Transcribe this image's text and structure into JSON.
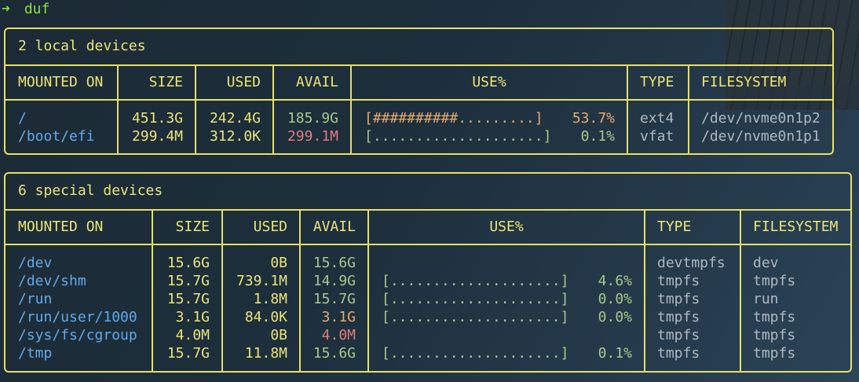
{
  "prompt": {
    "arrow": "➜",
    "command": "duf"
  },
  "local": {
    "title": "2 local devices",
    "headers": [
      "MOUNTED ON",
      "SIZE",
      "USED",
      "AVAIL",
      "USE%",
      "TYPE",
      "FILESYSTEM"
    ],
    "rows": [
      {
        "mount": "/",
        "size": "451.3G",
        "used": "242.4G",
        "avail": "185.9G",
        "bar": "[##########.........]",
        "pct": "53.7%",
        "type": "ext4",
        "fs": "/dev/nvme0n1p2"
      },
      {
        "mount": "/boot/efi",
        "size": "299.4M",
        "used": "312.0K",
        "avail": "299.1M",
        "bar": "[....................]",
        "pct": "0.1%",
        "type": "vfat",
        "fs": "/dev/nvme0n1p1"
      }
    ]
  },
  "special": {
    "title": "6 special devices",
    "headers": [
      "MOUNTED ON",
      "SIZE",
      "USED",
      "AVAIL",
      "USE%",
      "TYPE",
      "FILESYSTEM"
    ],
    "rows": [
      {
        "mount": "/dev",
        "size": "15.6G",
        "used": "0B",
        "avail": "15.6G",
        "bar": "",
        "pct": "",
        "type": "devtmpfs",
        "fs": "dev"
      },
      {
        "mount": "/dev/shm",
        "size": "15.7G",
        "used": "739.1M",
        "avail": "14.9G",
        "bar": "[....................]",
        "pct": "4.6%",
        "type": "tmpfs",
        "fs": "tmpfs"
      },
      {
        "mount": "/run",
        "size": "15.7G",
        "used": "1.8M",
        "avail": "15.7G",
        "bar": "[....................]",
        "pct": "0.0%",
        "type": "tmpfs",
        "fs": "run"
      },
      {
        "mount": "/run/user/1000",
        "size": "3.1G",
        "used": "84.0K",
        "avail": "3.1G",
        "bar": "[....................]",
        "pct": "0.0%",
        "type": "tmpfs",
        "fs": "tmpfs"
      },
      {
        "mount": "/sys/fs/cgroup",
        "size": "4.0M",
        "used": "0B",
        "avail": "4.0M",
        "bar": "",
        "pct": "",
        "type": "tmpfs",
        "fs": "tmpfs"
      },
      {
        "mount": "/tmp",
        "size": "15.7G",
        "used": "11.8M",
        "avail": "15.6G",
        "bar": "[....................]",
        "pct": "0.1%",
        "type": "tmpfs",
        "fs": "tmpfs"
      }
    ]
  },
  "colors": {
    "border": "#e6de6a",
    "mount": "#62a8e8",
    "avail_ok": "#a7c88a",
    "avail_warn": "#e6a86a",
    "avail_low": "#e07b7b",
    "prompt": "#8ae234"
  }
}
